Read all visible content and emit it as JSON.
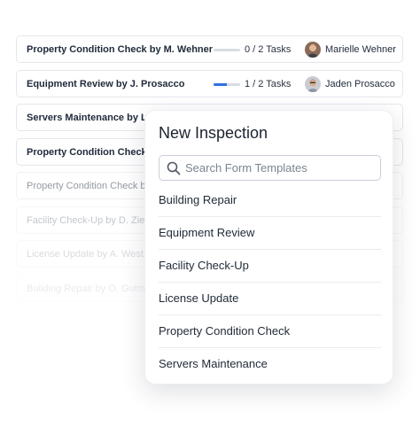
{
  "inspections": [
    {
      "title": "Property Condition Check by M. Wehner",
      "tasks": "0 / 2 Tasks",
      "progress": 0,
      "assignee": "Marielle Wehner"
    },
    {
      "title": "Equipment Review by J. Prosacco",
      "tasks": "1 / 2 Tasks",
      "progress": 0.5,
      "assignee": "Jaden Prosacco"
    },
    {
      "title": "Servers Maintenance by L. Ti"
    },
    {
      "title": "Property Condition Check by"
    },
    {
      "title": "Property Condition Check by"
    },
    {
      "title": "Facility Check-Up by D. Ziem"
    },
    {
      "title": "License Update by A. West"
    },
    {
      "title": "Building Repair by O. Gutmar"
    }
  ],
  "colors": {
    "progress_fill": "#2f6fe0",
    "progress_track": "#d9dde3"
  },
  "panel": {
    "title": "New Inspection",
    "search_placeholder": "Search Form Templates",
    "search_icon": "search-icon",
    "templates": [
      "Building Repair",
      "Equipment Review",
      "Facility Check-Up",
      "License Update",
      "Property Condition Check",
      "Servers Maintenance"
    ]
  }
}
